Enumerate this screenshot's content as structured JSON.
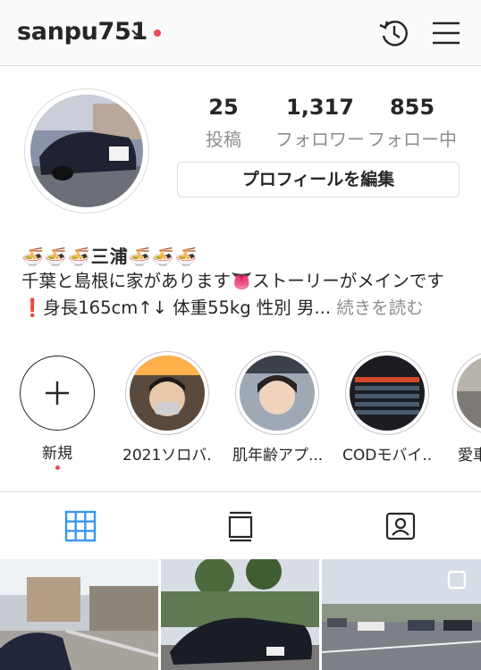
{
  "header": {
    "username": "sanpu751",
    "icons": [
      "chevron-down-icon",
      "notification-dot",
      "activity-history-icon",
      "menu-icon"
    ],
    "accent": "#ed4956"
  },
  "profile": {
    "stats": {
      "posts": {
        "value": "25",
        "label": "投稿"
      },
      "followers": {
        "value": "1,317",
        "label": "フォロワー"
      },
      "following": {
        "value": "855",
        "label": "フォロー中"
      }
    },
    "edit_label": "プロフィールを編集",
    "bio_name": "🍜🍜🍜三浦🍜🍜🍜",
    "bio_text": "千葉と島根に家があります👅ストーリーがメインです❗身長165cm↑↓ 体重55kg 性別 男...",
    "bio_more": "続きを読む"
  },
  "highlights": [
    {
      "label": "新規",
      "icon": "plus-icon"
    },
    {
      "label": "2021ソロバ..."
    },
    {
      "label": "肌年齢アプ..."
    },
    {
      "label": "CODモバイ..."
    },
    {
      "label": "愛車"
    }
  ],
  "tabs": [
    {
      "name": "grid",
      "icon": "grid-icon",
      "active": true
    },
    {
      "name": "feed",
      "icon": "feed-icon",
      "active": false
    },
    {
      "name": "tagged",
      "icon": "tagged-icon",
      "active": false
    }
  ],
  "colors": {
    "link": "#3897f0",
    "muted": "#8e8e8e",
    "border": "#dbdbdb"
  }
}
